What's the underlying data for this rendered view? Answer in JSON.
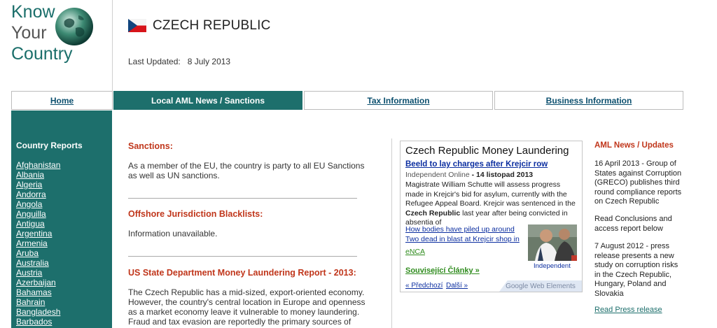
{
  "logo": {
    "line1": "Know",
    "line2": "Your",
    "line3": "Country"
  },
  "header": {
    "country": "CZECH REPUBLIC",
    "updated_label": "Last Updated:",
    "updated_date": "8 July 2013"
  },
  "nav": {
    "home": "Home",
    "aml": "Local AML News / Sanctions",
    "tax": "Tax Information",
    "business": "Business Information"
  },
  "sidebar": {
    "title": "Country Reports",
    "countries": [
      "Afghanistan",
      "Albania",
      "Algeria",
      "Andorra",
      "Angola",
      "Anguilla",
      "Antigua",
      "Argentina",
      "Armenia",
      "Aruba",
      "Australia",
      "Austria",
      "Azerbaijan",
      "Bahamas",
      "Bahrain",
      "Bangladesh",
      "Barbados"
    ]
  },
  "main": {
    "sanctions_title": "Sanctions:",
    "sanctions_text": "As a member of the EU, the country is party to all EU Sanctions as well as UN sanctions.",
    "offshore_title": "Offshore Jurisdiction Blacklists:",
    "offshore_text": "Information unavailable.",
    "us_title": "US State Department Money Laundering Report - 2013:",
    "us_text": "The Czech Republic has a mid-sized, export-oriented economy. However, the country's central location in Europe and openness as a market economy leave it vulnerable to money laundering. Fraud and tax evasion are reportedly the primary sources of"
  },
  "widget": {
    "title": "Czech Republic Money Laundering",
    "headline": "Beeld to lay charges after Krejcir row",
    "source": "Independent Online",
    "date": "- 14 listopad 2013",
    "body_1": "Magistrate William Schutte will assess progress made in Krejcir's bid for asylum, currently with the Refugee Appeal Board. Krejcir was sentenced in the ",
    "body_bold": "Czech Republic",
    "body_2": " last year after being convicted in absentia of",
    "link1": "How bodies have piled up around",
    "link2": "Two dead in blast at Krejcir shop in",
    "link3": "eNCA",
    "thumb_caption": "Independent",
    "related": "Související Články »",
    "prev": "« Předchozí",
    "next": "Další »",
    "brand": "Google Web Elements"
  },
  "right": {
    "title": "AML News / Updates",
    "item1": "16 April 2013 - Group of States against Corruption (GRECO) publishes third round compliance reports on Czech Republic",
    "item2": "Read Conclusions and access report below",
    "item3": "7 August 2012 - press release presents a new study on corruption risks in the Czech Republic, Hungary, Poland and Slovakia",
    "link": "Read Press release"
  },
  "colors": {
    "teal": "#1d6f6c",
    "accent_red": "#c0361b",
    "link_blue": "#0b2ea0",
    "green": "#2e8b1c"
  }
}
